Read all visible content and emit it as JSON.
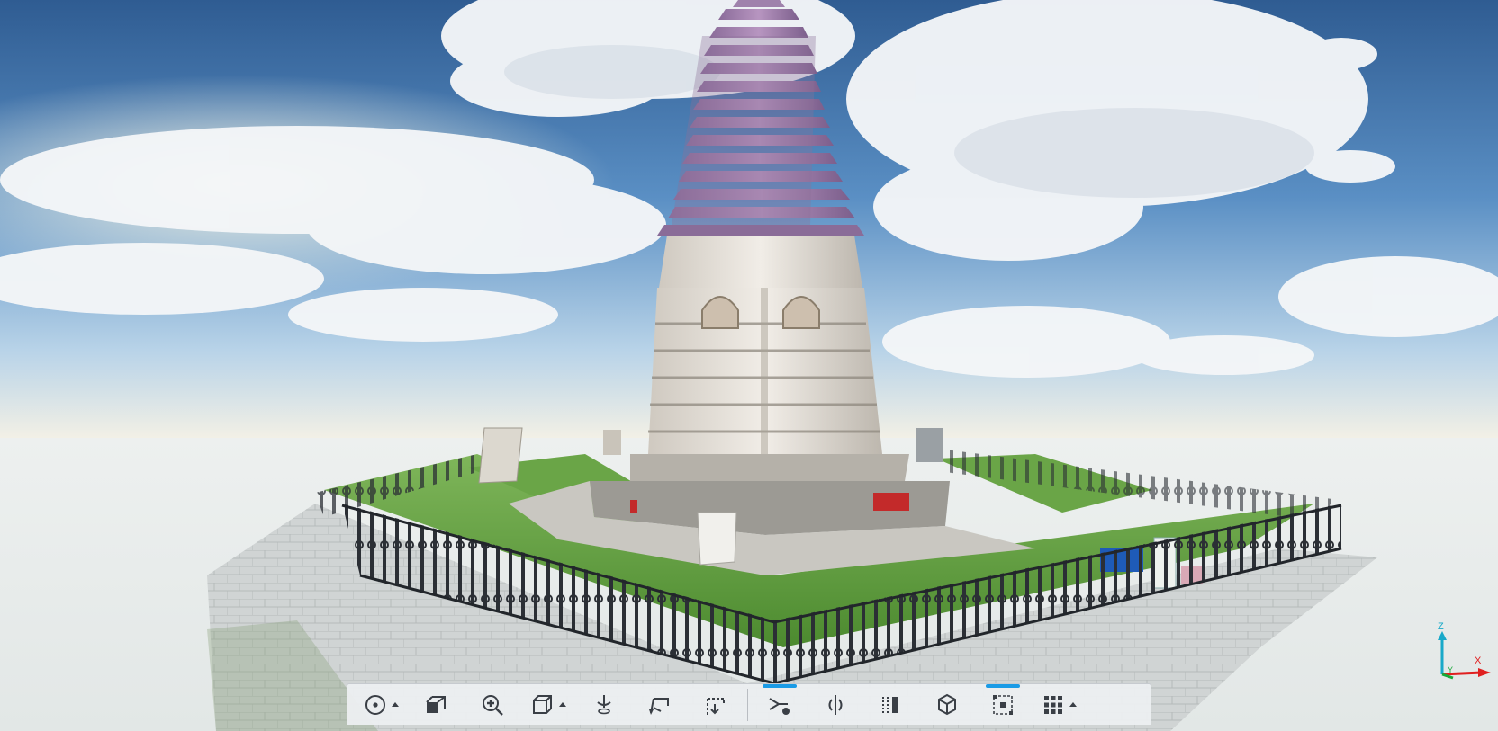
{
  "viewer": {
    "scene_description": "",
    "colors": {
      "sky_top": "#3e6b9e",
      "sky_horizon": "#eef3f6",
      "ground": "#e9eded",
      "pagoda_roof": "#9b7aa6",
      "pagoda_body": "#e6e2dc",
      "grass": "#5c9a3c",
      "fence": "#2b2f35",
      "active_accent": "#1a9be6"
    }
  },
  "toolbar": {
    "tools": [
      {
        "name": "orbit-point-tool",
        "icon": "target-dot-icon",
        "has_dropdown": true
      },
      {
        "name": "camera-views-tool",
        "icon": "camera-box-icon",
        "has_dropdown": false
      },
      {
        "name": "zoom-tool",
        "icon": "zoom-in-icon",
        "has_dropdown": false
      },
      {
        "name": "view-cube-tool",
        "icon": "cube-outline-icon",
        "has_dropdown": true
      },
      {
        "name": "walk-tool",
        "icon": "person-walk-icon",
        "has_dropdown": false
      },
      {
        "name": "measure-tool",
        "icon": "ruler-arrow-icon",
        "has_dropdown": false
      },
      {
        "name": "section-tool",
        "icon": "section-plane-icon",
        "has_dropdown": false
      },
      {
        "name": "point-cloud-tool",
        "icon": "cloud-points-icon",
        "has_dropdown": false,
        "active": true
      },
      {
        "name": "split-tool",
        "icon": "split-compare-icon",
        "has_dropdown": false
      },
      {
        "name": "clip-tool",
        "icon": "clip-box-icon",
        "has_dropdown": false
      },
      {
        "name": "bounding-box-tool",
        "icon": "box-3d-icon",
        "has_dropdown": false
      },
      {
        "name": "selection-tool",
        "icon": "select-points-icon",
        "has_dropdown": false,
        "active": true
      },
      {
        "name": "grid-menu-tool",
        "icon": "grid-menu-icon",
        "has_dropdown": true
      }
    ]
  },
  "axis_gizmo": {
    "x_label": "X",
    "y_label": "Y",
    "z_label": "Z",
    "x_color": "#e02020",
    "y_color": "#18a83a",
    "z_color": "#19a9c9"
  }
}
